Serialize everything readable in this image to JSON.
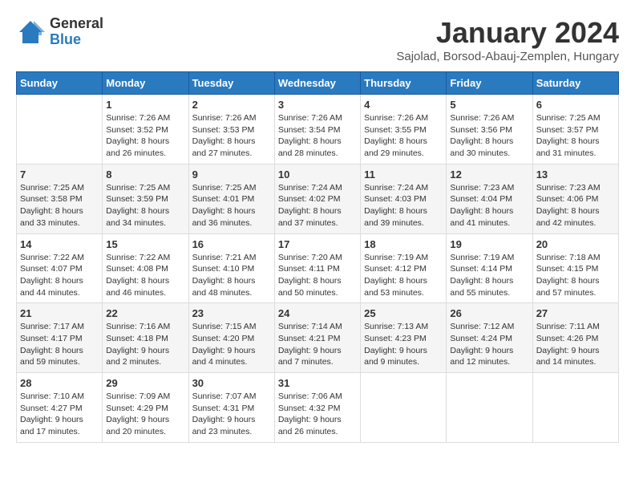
{
  "logo": {
    "general": "General",
    "blue": "Blue"
  },
  "title": "January 2024",
  "location": "Sajolad, Borsod-Abauj-Zemplen, Hungary",
  "headers": [
    "Sunday",
    "Monday",
    "Tuesday",
    "Wednesday",
    "Thursday",
    "Friday",
    "Saturday"
  ],
  "weeks": [
    [
      {
        "day": "",
        "info": ""
      },
      {
        "day": "1",
        "info": "Sunrise: 7:26 AM\nSunset: 3:52 PM\nDaylight: 8 hours and 26 minutes."
      },
      {
        "day": "2",
        "info": "Sunrise: 7:26 AM\nSunset: 3:53 PM\nDaylight: 8 hours and 27 minutes."
      },
      {
        "day": "3",
        "info": "Sunrise: 7:26 AM\nSunset: 3:54 PM\nDaylight: 8 hours and 28 minutes."
      },
      {
        "day": "4",
        "info": "Sunrise: 7:26 AM\nSunset: 3:55 PM\nDaylight: 8 hours and 29 minutes."
      },
      {
        "day": "5",
        "info": "Sunrise: 7:26 AM\nSunset: 3:56 PM\nDaylight: 8 hours and 30 minutes."
      },
      {
        "day": "6",
        "info": "Sunrise: 7:25 AM\nSunset: 3:57 PM\nDaylight: 8 hours and 31 minutes."
      }
    ],
    [
      {
        "day": "7",
        "info": "Sunrise: 7:25 AM\nSunset: 3:58 PM\nDaylight: 8 hours and 33 minutes."
      },
      {
        "day": "8",
        "info": "Sunrise: 7:25 AM\nSunset: 3:59 PM\nDaylight: 8 hours and 34 minutes."
      },
      {
        "day": "9",
        "info": "Sunrise: 7:25 AM\nSunset: 4:01 PM\nDaylight: 8 hours and 36 minutes."
      },
      {
        "day": "10",
        "info": "Sunrise: 7:24 AM\nSunset: 4:02 PM\nDaylight: 8 hours and 37 minutes."
      },
      {
        "day": "11",
        "info": "Sunrise: 7:24 AM\nSunset: 4:03 PM\nDaylight: 8 hours and 39 minutes."
      },
      {
        "day": "12",
        "info": "Sunrise: 7:23 AM\nSunset: 4:04 PM\nDaylight: 8 hours and 41 minutes."
      },
      {
        "day": "13",
        "info": "Sunrise: 7:23 AM\nSunset: 4:06 PM\nDaylight: 8 hours and 42 minutes."
      }
    ],
    [
      {
        "day": "14",
        "info": "Sunrise: 7:22 AM\nSunset: 4:07 PM\nDaylight: 8 hours and 44 minutes."
      },
      {
        "day": "15",
        "info": "Sunrise: 7:22 AM\nSunset: 4:08 PM\nDaylight: 8 hours and 46 minutes."
      },
      {
        "day": "16",
        "info": "Sunrise: 7:21 AM\nSunset: 4:10 PM\nDaylight: 8 hours and 48 minutes."
      },
      {
        "day": "17",
        "info": "Sunrise: 7:20 AM\nSunset: 4:11 PM\nDaylight: 8 hours and 50 minutes."
      },
      {
        "day": "18",
        "info": "Sunrise: 7:19 AM\nSunset: 4:12 PM\nDaylight: 8 hours and 53 minutes."
      },
      {
        "day": "19",
        "info": "Sunrise: 7:19 AM\nSunset: 4:14 PM\nDaylight: 8 hours and 55 minutes."
      },
      {
        "day": "20",
        "info": "Sunrise: 7:18 AM\nSunset: 4:15 PM\nDaylight: 8 hours and 57 minutes."
      }
    ],
    [
      {
        "day": "21",
        "info": "Sunrise: 7:17 AM\nSunset: 4:17 PM\nDaylight: 8 hours and 59 minutes."
      },
      {
        "day": "22",
        "info": "Sunrise: 7:16 AM\nSunset: 4:18 PM\nDaylight: 9 hours and 2 minutes."
      },
      {
        "day": "23",
        "info": "Sunrise: 7:15 AM\nSunset: 4:20 PM\nDaylight: 9 hours and 4 minutes."
      },
      {
        "day": "24",
        "info": "Sunrise: 7:14 AM\nSunset: 4:21 PM\nDaylight: 9 hours and 7 minutes."
      },
      {
        "day": "25",
        "info": "Sunrise: 7:13 AM\nSunset: 4:23 PM\nDaylight: 9 hours and 9 minutes."
      },
      {
        "day": "26",
        "info": "Sunrise: 7:12 AM\nSunset: 4:24 PM\nDaylight: 9 hours and 12 minutes."
      },
      {
        "day": "27",
        "info": "Sunrise: 7:11 AM\nSunset: 4:26 PM\nDaylight: 9 hours and 14 minutes."
      }
    ],
    [
      {
        "day": "28",
        "info": "Sunrise: 7:10 AM\nSunset: 4:27 PM\nDaylight: 9 hours and 17 minutes."
      },
      {
        "day": "29",
        "info": "Sunrise: 7:09 AM\nSunset: 4:29 PM\nDaylight: 9 hours and 20 minutes."
      },
      {
        "day": "30",
        "info": "Sunrise: 7:07 AM\nSunset: 4:31 PM\nDaylight: 9 hours and 23 minutes."
      },
      {
        "day": "31",
        "info": "Sunrise: 7:06 AM\nSunset: 4:32 PM\nDaylight: 9 hours and 26 minutes."
      },
      {
        "day": "",
        "info": ""
      },
      {
        "day": "",
        "info": ""
      },
      {
        "day": "",
        "info": ""
      }
    ]
  ]
}
